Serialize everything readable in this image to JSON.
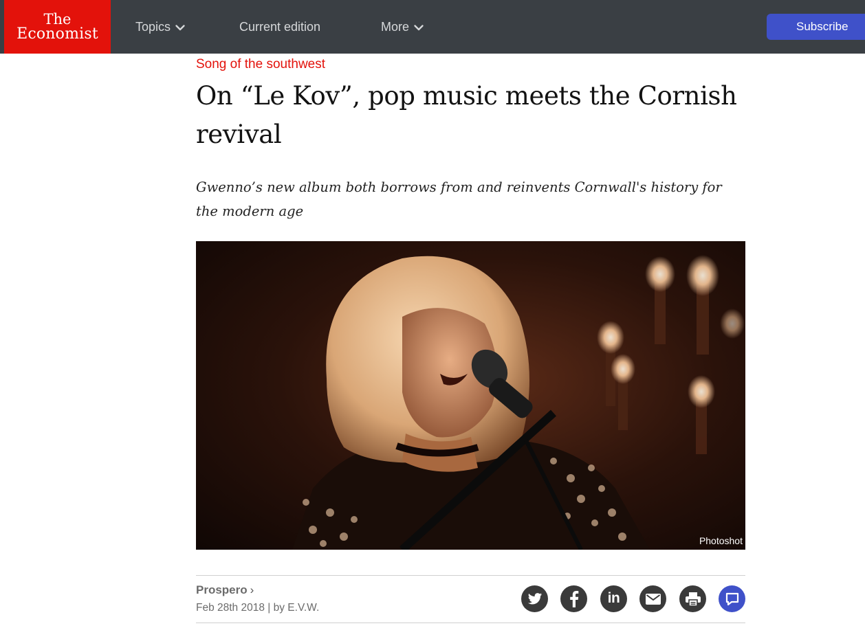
{
  "nav": {
    "logo_line1": "The",
    "logo_line2": "Economist",
    "items": [
      {
        "label": "Topics",
        "icon": "chevron-down-icon"
      },
      {
        "label": "Current edition"
      },
      {
        "label": "More",
        "icon": "chevron-down-icon"
      }
    ],
    "subscribe_label": "Subscribe"
  },
  "article": {
    "kicker": "Song of the southwest",
    "headline": "On “Le Kov”, pop music meets the Cornish revival",
    "standfirst": "Gwenno’s new album both borrows from and reinvents Cornwall's history for the modern age",
    "image_credit": "Photoshot",
    "section": "Prospero",
    "section_arrow": "›",
    "date": "Feb 28th 2018",
    "byline": "| by E.V.W."
  },
  "share": [
    {
      "icon": "twitter-icon"
    },
    {
      "icon": "facebook-icon"
    },
    {
      "icon": "linkedin-icon",
      "text": "in"
    },
    {
      "icon": "mail-icon"
    },
    {
      "icon": "print-icon"
    },
    {
      "icon": "comment-icon"
    }
  ],
  "colors": {
    "nav_bg": "#3a3f44",
    "brand_red": "#e3120b",
    "subscribe_blue": "#3f51c9",
    "share_icon_bg": "#3a3a3a"
  }
}
